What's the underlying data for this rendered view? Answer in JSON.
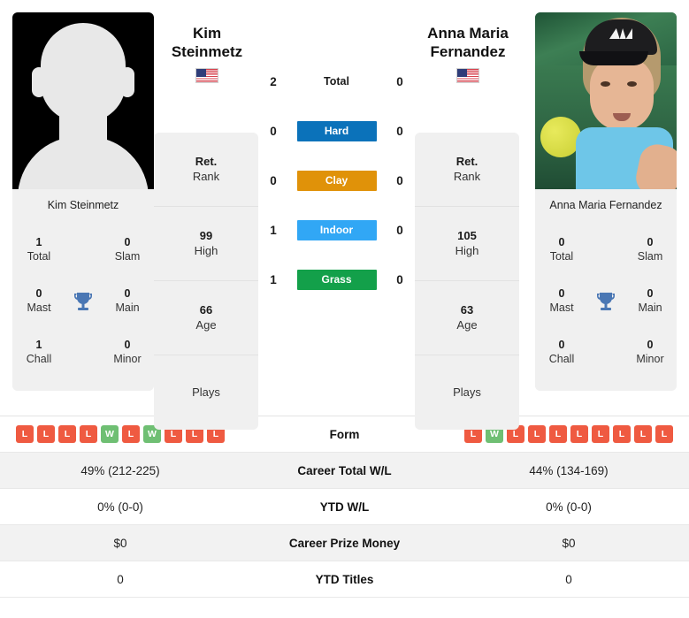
{
  "players": {
    "left": {
      "first_name": "Kim",
      "last_name": "Steinmetz",
      "full_name": "Kim Steinmetz",
      "flag": "us-flag-icon",
      "photo": "placeholder-avatar-silhouette",
      "titles": {
        "total": "1",
        "total_label": "Total",
        "slam": "0",
        "slam_label": "Slam",
        "mast": "0",
        "mast_label": "Mast",
        "main": "0",
        "main_label": "Main",
        "chall": "1",
        "chall_label": "Chall",
        "minor": "0",
        "minor_label": "Minor"
      },
      "ranks": [
        {
          "value": "Ret.",
          "label": "Rank"
        },
        {
          "value": "99",
          "label": "High"
        },
        {
          "value": "66",
          "label": "Age"
        },
        {
          "value": "",
          "label": "Plays"
        }
      ],
      "form": [
        "L",
        "L",
        "L",
        "L",
        "W",
        "L",
        "W",
        "L",
        "L",
        "L"
      ],
      "career_total_wl": "49% (212-225)",
      "ytd_wl": "0% (0-0)",
      "career_prize_money": "$0",
      "ytd_titles": "0"
    },
    "right": {
      "first_name": "Anna Maria",
      "last_name": "Fernandez",
      "full_name": "Anna Maria Fernandez",
      "flag": "us-flag-icon",
      "photo": "player-action-photo",
      "titles": {
        "total": "0",
        "total_label": "Total",
        "slam": "0",
        "slam_label": "Slam",
        "mast": "0",
        "mast_label": "Mast",
        "main": "0",
        "main_label": "Main",
        "chall": "0",
        "chall_label": "Chall",
        "minor": "0",
        "minor_label": "Minor"
      },
      "ranks": [
        {
          "value": "Ret.",
          "label": "Rank"
        },
        {
          "value": "105",
          "label": "High"
        },
        {
          "value": "63",
          "label": "Age"
        },
        {
          "value": "",
          "label": "Plays"
        }
      ],
      "form": [
        "L",
        "W",
        "L",
        "L",
        "L",
        "L",
        "L",
        "L",
        "L",
        "L"
      ],
      "career_total_wl": "44% (134-169)",
      "ytd_wl": "0% (0-0)",
      "career_prize_money": "$0",
      "ytd_titles": "0"
    }
  },
  "head_to_head": [
    {
      "label": "Total",
      "left": "2",
      "right": "0",
      "type": "total",
      "color": ""
    },
    {
      "label": "Hard",
      "left": "0",
      "right": "0",
      "type": "surface",
      "color": "#0b72ba"
    },
    {
      "label": "Clay",
      "left": "0",
      "right": "0",
      "type": "surface",
      "color": "#e09209"
    },
    {
      "label": "Indoor",
      "left": "1",
      "right": "0",
      "type": "surface",
      "color": "#31a7f5"
    },
    {
      "label": "Grass",
      "left": "1",
      "right": "0",
      "type": "surface",
      "color": "#13a04a"
    }
  ],
  "stats_table": [
    {
      "label": "Form",
      "left": "",
      "right": "",
      "kind": "form"
    },
    {
      "label": "Career Total W/L",
      "left": "49% (212-225)",
      "right": "44% (134-169)",
      "kind": "text"
    },
    {
      "label": "YTD W/L",
      "left": "0% (0-0)",
      "right": "0% (0-0)",
      "kind": "text"
    },
    {
      "label": "Career Prize Money",
      "left": "$0",
      "right": "$0",
      "kind": "text"
    },
    {
      "label": "YTD Titles",
      "left": "0",
      "right": "0",
      "kind": "text"
    }
  ],
  "colors": {
    "hard": "#0b72ba",
    "clay": "#e09209",
    "indoor": "#31a7f5",
    "grass": "#13a04a",
    "win": "#6fbf73",
    "loss": "#ef5a41",
    "panel_bg": "#f0f0f0",
    "trophy": "#4a77b4"
  }
}
